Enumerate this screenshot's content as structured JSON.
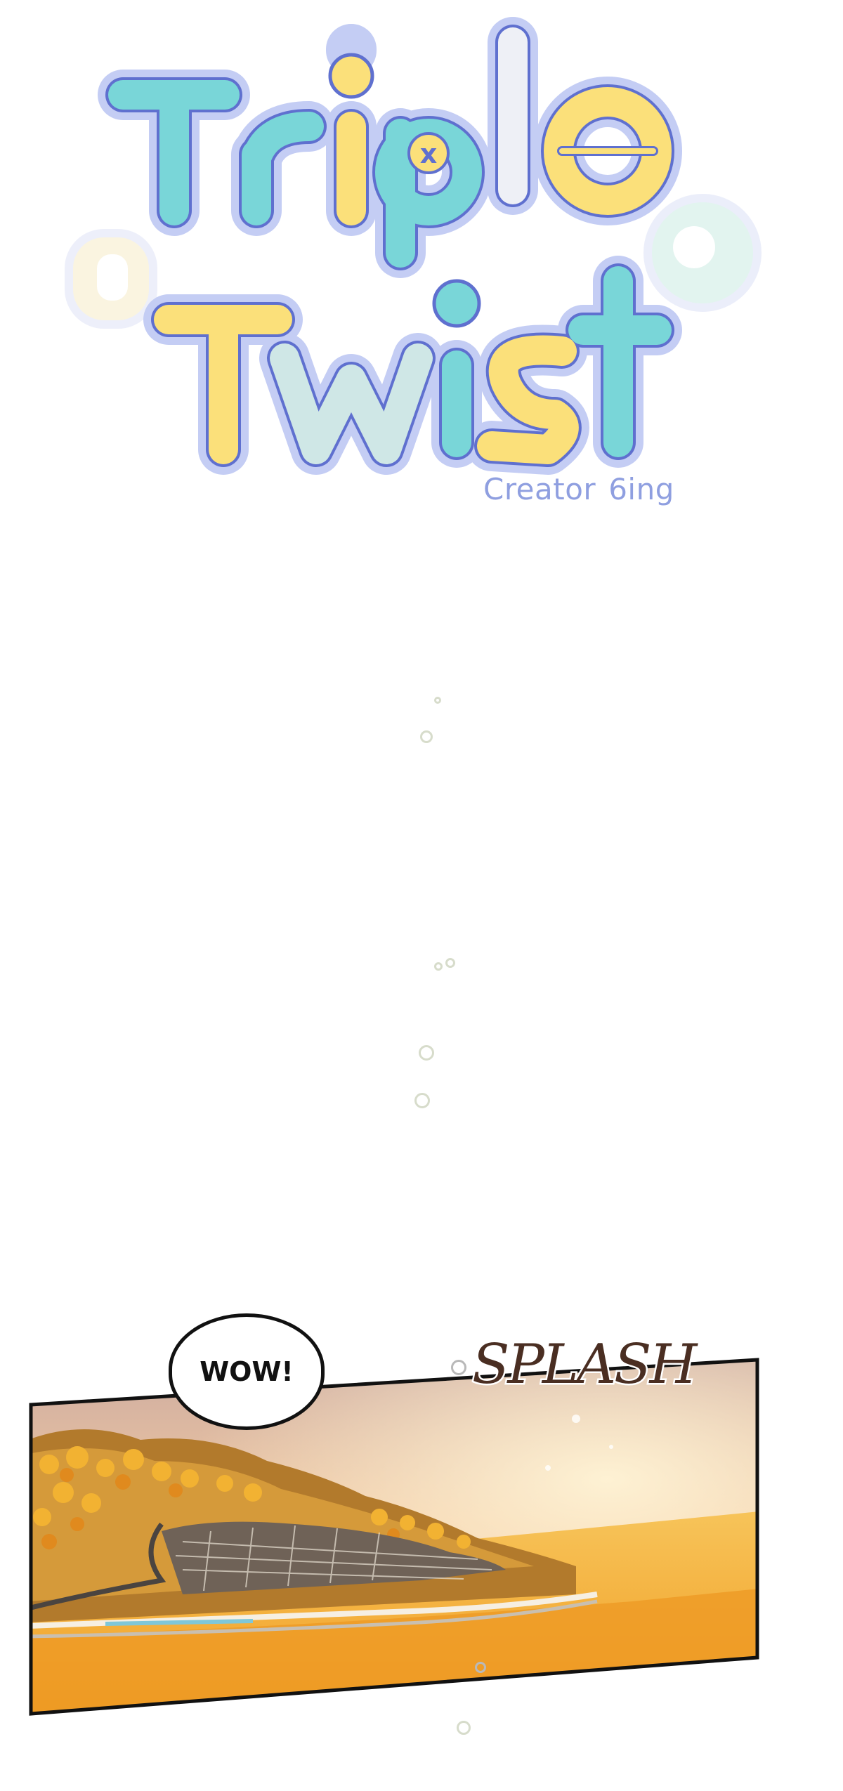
{
  "title": {
    "line1": [
      "T",
      "r",
      "i",
      "p",
      "l",
      "e"
    ],
    "line2": [
      "T",
      "w",
      "i",
      "s",
      "t"
    ],
    "x_mark": "x",
    "logo_colors": {
      "teal": "#79d6d8",
      "yellow": "#fbe07a",
      "pale_teal": "#cfe7e6",
      "white": "#eef0f6",
      "outline": "#5f70cf",
      "halo": "#c4cdf4"
    }
  },
  "credit": {
    "label": "Creator",
    "name": "6ing"
  },
  "panel": {
    "speech_bubble": "WOW!",
    "sound_effect": "SPLASH",
    "scene": "autumn-seaside-town-at-sunset"
  }
}
